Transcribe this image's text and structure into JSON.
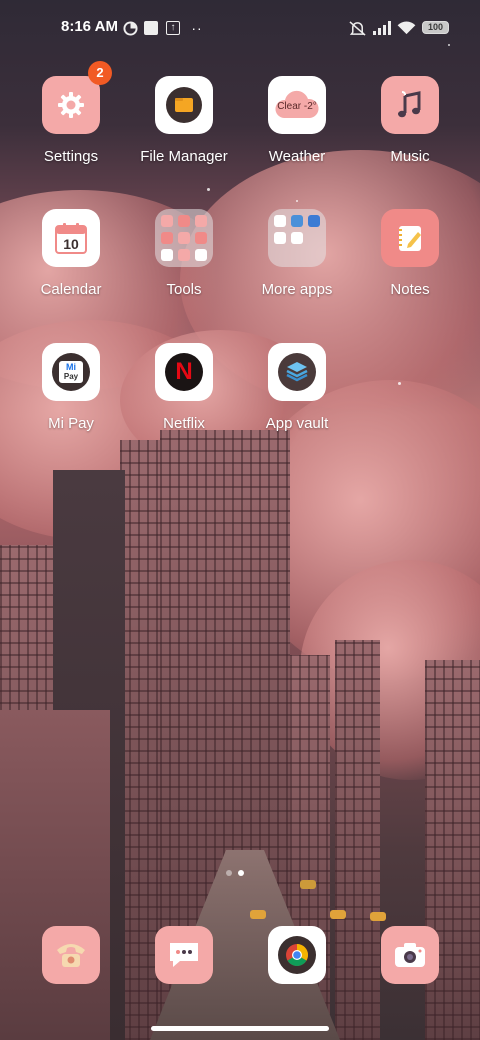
{
  "status_bar": {
    "time": "8:16 AM",
    "icons_left": [
      "data-saver-icon",
      "notification-square-icon",
      "upload-icon",
      "more-dots-icon"
    ],
    "icons_right": [
      "mute-icon",
      "signal-icon",
      "wifi-icon"
    ],
    "battery": "100"
  },
  "apps": [
    {
      "label": "Settings",
      "icon": "gear-icon",
      "badge": "2"
    },
    {
      "label": "File Manager",
      "icon": "folder-icon"
    },
    {
      "label": "Weather",
      "icon": "cloud-icon",
      "tile_text": "Clear -2°"
    },
    {
      "label": "Music",
      "icon": "music-note-icon"
    },
    {
      "label": "Calendar",
      "icon": "calendar-icon",
      "tile_text": "10"
    },
    {
      "label": "Tools",
      "icon": "folder-grid-icon"
    },
    {
      "label": "More apps",
      "icon": "folder-grid-icon"
    },
    {
      "label": "Notes",
      "icon": "notepad-icon"
    },
    {
      "label": "Mi Pay",
      "icon": "mi-pay-icon",
      "tile_text_top": "Mi",
      "tile_text_bottom": "Pay"
    },
    {
      "label": "Netflix",
      "icon": "netflix-icon",
      "tile_text": "N"
    },
    {
      "label": "App vault",
      "icon": "layers-icon"
    }
  ],
  "dock": [
    {
      "name": "Phone",
      "icon": "telephone-icon"
    },
    {
      "name": "Messages",
      "icon": "chat-bubble-icon"
    },
    {
      "name": "Chrome",
      "icon": "chrome-icon"
    },
    {
      "name": "Camera",
      "icon": "camera-icon"
    }
  ],
  "colors": {
    "tile_pink": "#f4a9a8",
    "tile_white": "#ffffff",
    "badge": "#f15a24",
    "netflix_red": "#e50914"
  }
}
